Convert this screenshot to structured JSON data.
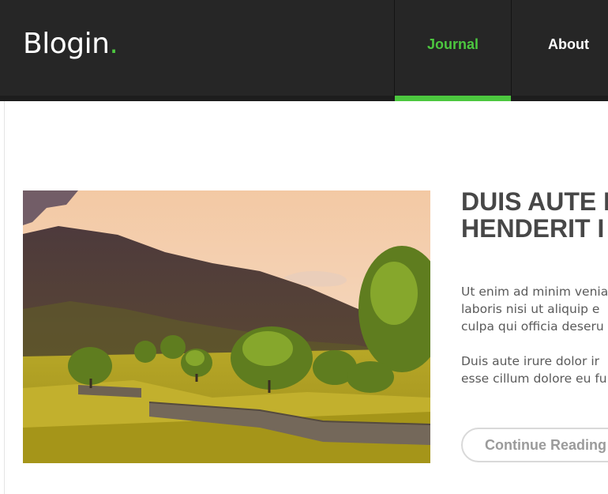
{
  "site": {
    "logo_text": "Blogin",
    "logo_dot": ".",
    "accent_color": "#4cc73f"
  },
  "nav": {
    "items": [
      {
        "label": "Journal",
        "active": true
      },
      {
        "label": "About",
        "active": false
      }
    ]
  },
  "post": {
    "image": "landscape-photo",
    "title": "DUIS AUTE I\nHENDERIT I",
    "paragraph1": "Ut enim ad minim venia\nlaboris nisi ut aliquip e\nculpa qui officia deseru",
    "paragraph2": "Duis aute irure dolor ir\nesse cillum dolore eu fu",
    "button_label": "Continue Reading"
  }
}
